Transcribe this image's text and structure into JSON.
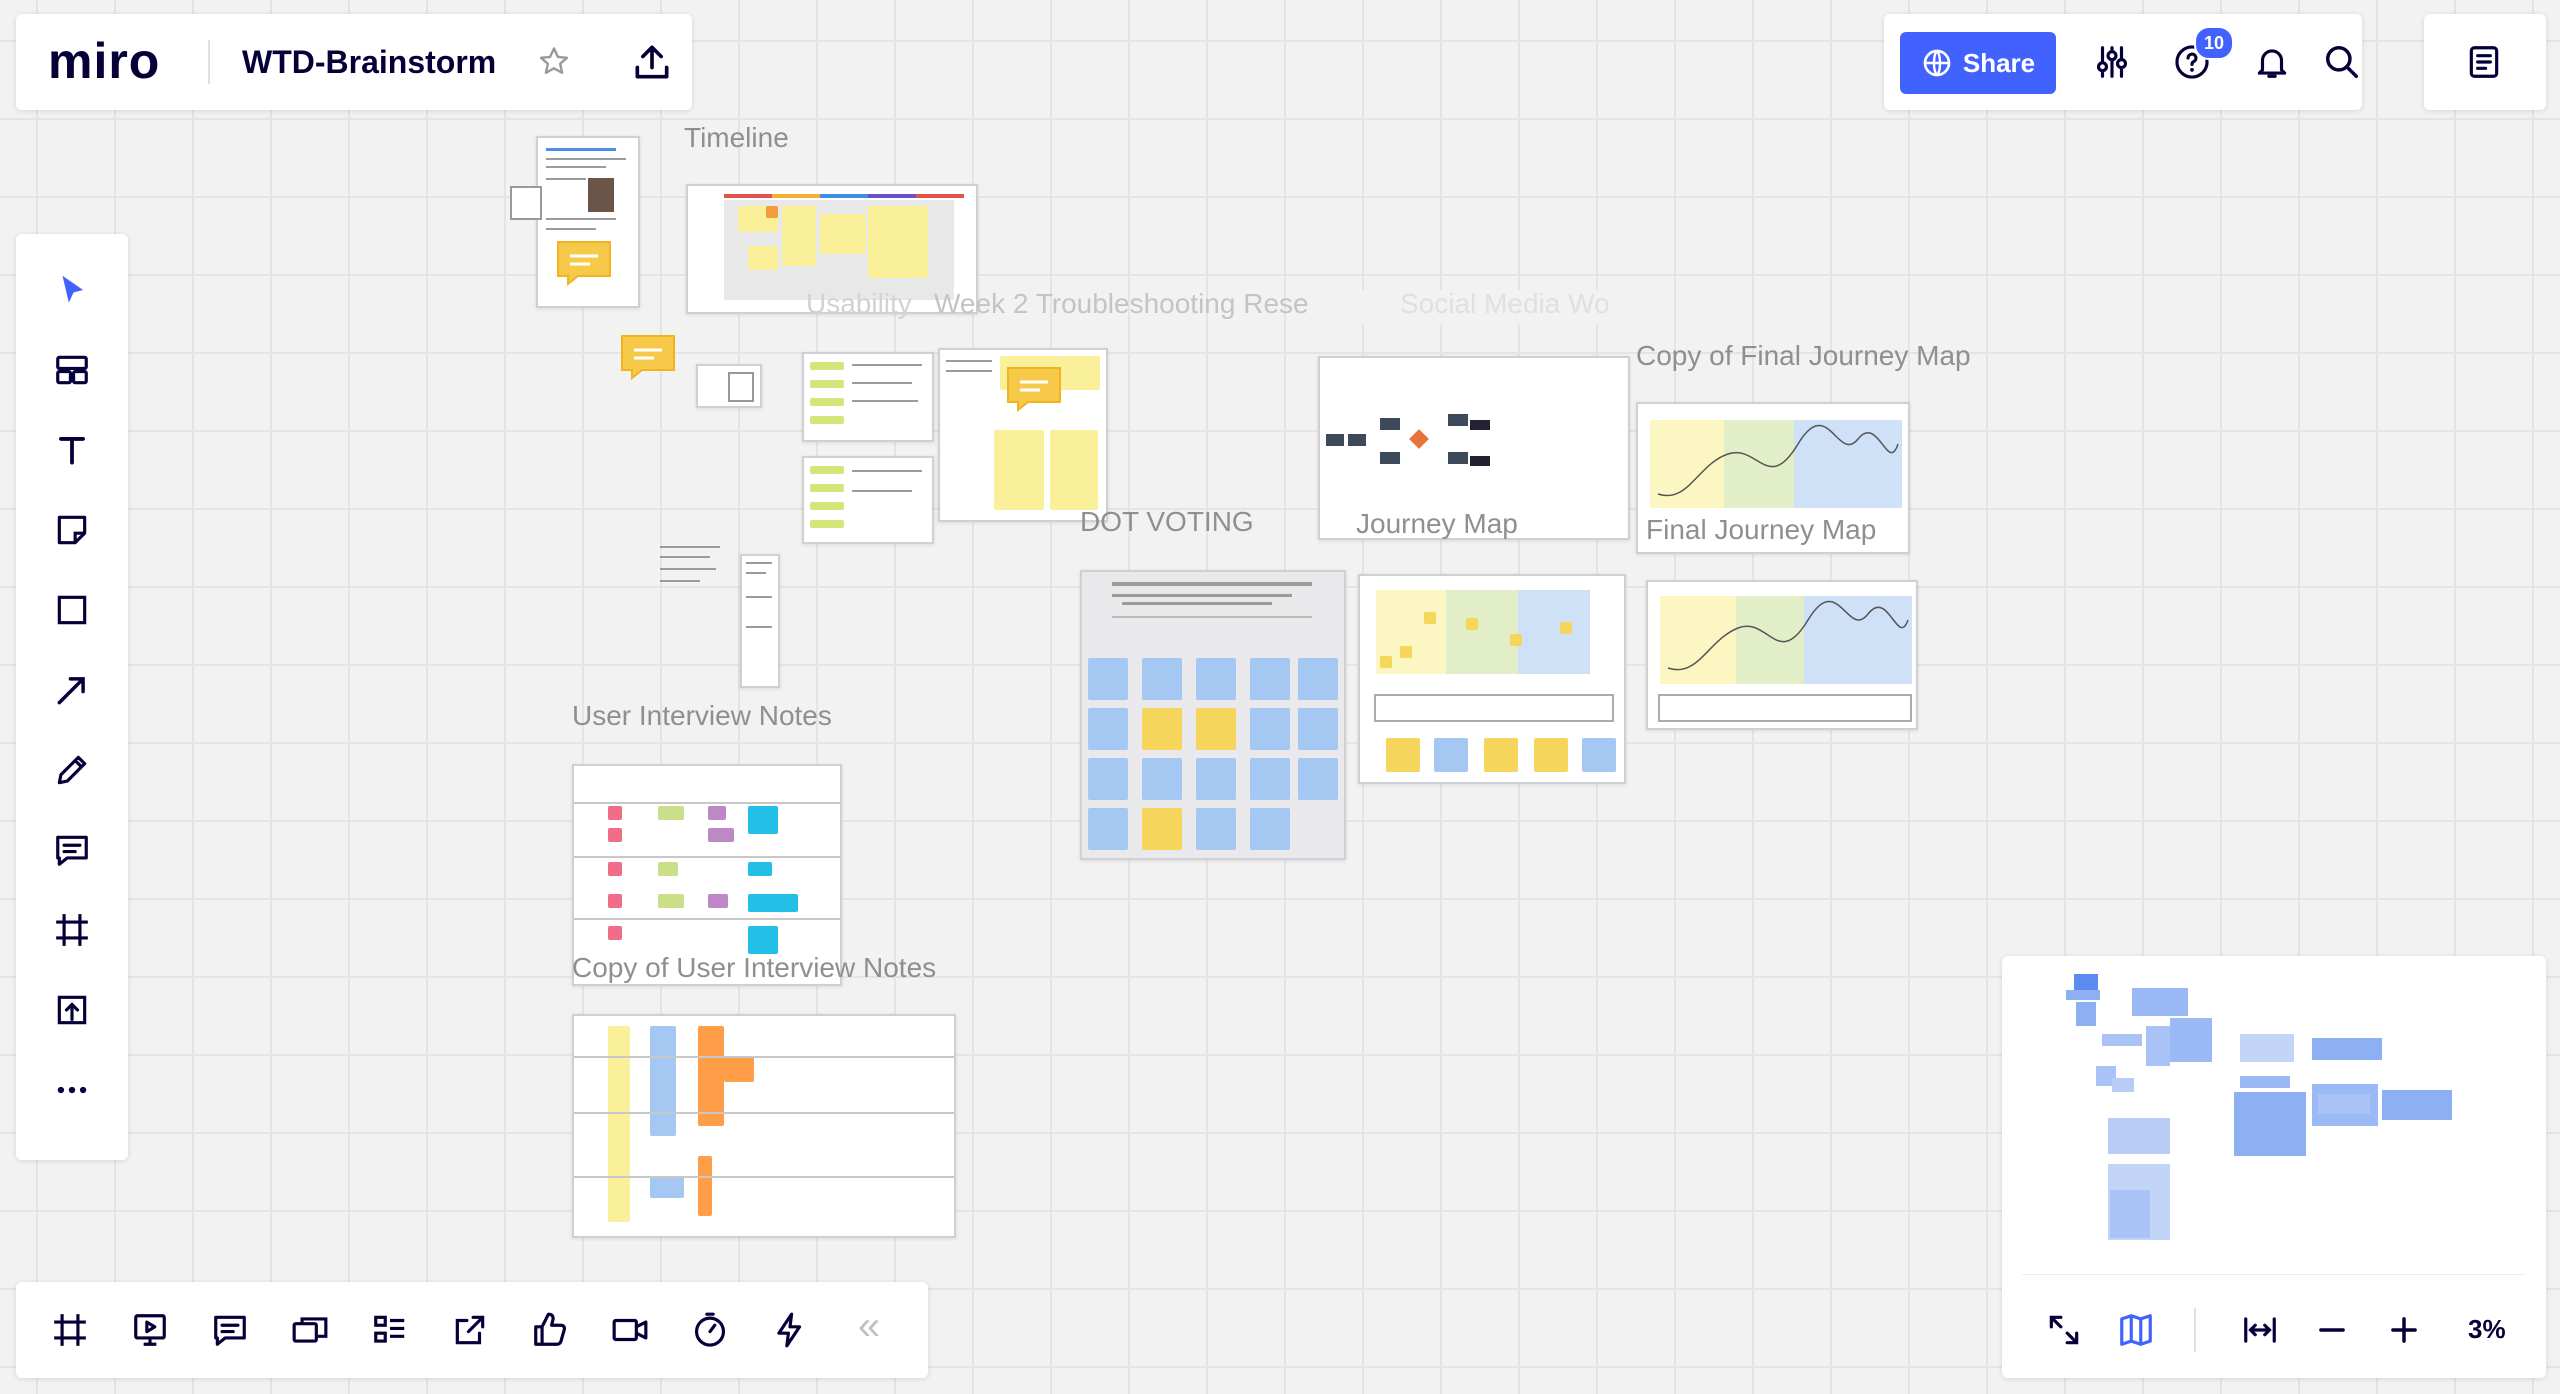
{
  "app": {
    "logo": "miro",
    "board_title": "WTD-Brainstorm"
  },
  "header": {
    "share_label": "Share",
    "help_badge": "10"
  },
  "canvas": {
    "labels": {
      "timeline": "Timeline",
      "week2": "Week 2 Troubleshooting Rese",
      "usability": "Usability",
      "social": "Social Media Wo",
      "copy_final_journey": "Copy of Final Journey Map",
      "dot_voting": "DOT VOTING",
      "journey_map": "Journey Map",
      "final_journey": "Final Journey Map",
      "user_interview": "User Interview Notes",
      "copy_user_interview": "Copy of User Interview Notes"
    }
  },
  "colors": {
    "accent": "#4262ff",
    "sticky_yellow": "#f6d55c",
    "sticky_blue": "#a5c8f3",
    "sticky_pink": "#f16c87",
    "sticky_green": "#c9df8a",
    "sticky_purple": "#be88c7",
    "sticky_cyan": "#23bfe7",
    "sticky_orange": "#ff9d48",
    "badge": "#4262ff"
  },
  "left_toolbar": {
    "tools": [
      "select-icon",
      "templates-icon",
      "text-icon",
      "sticky-note-icon",
      "shape-icon",
      "arrow-icon",
      "pen-icon",
      "comment-icon",
      "frame-icon",
      "upload-icon",
      "more-icon"
    ]
  },
  "bottom_toolbar": {
    "tools": [
      "frames-icon",
      "presentation-icon",
      "comments-icon",
      "cards-icon",
      "kanban-icon",
      "share-screen-icon",
      "voting-icon",
      "video-icon",
      "timer-icon",
      "lightning-icon"
    ],
    "collapse": "«"
  },
  "zoom": {
    "level": "3%"
  }
}
